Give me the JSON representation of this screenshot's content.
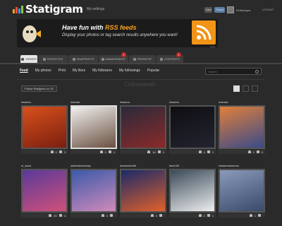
{
  "header": {
    "brand": "Statigram",
    "my_settings": "My settings",
    "like_btn": "Like",
    "tweet_btn": "Tweet",
    "username": "KelleyAgua",
    "logout": "LOGOUT",
    "logo_colors": [
      "#f4a224",
      "#e94e3c",
      "#3c9ad6",
      "#8cc63e"
    ]
  },
  "banner": {
    "title_pre": "Have fun with ",
    "title_accent": "RSS feeds",
    "subtitle": "Display your photos or tag search results anywhere you want!",
    "close": "close",
    "accent_color": "#f7a21a"
  },
  "tabs": [
    {
      "label": "VIEWER",
      "active": true,
      "badge": ""
    },
    {
      "label": "STATISTICS",
      "active": false,
      "badge": ""
    },
    {
      "label": "SNAPSHOTS",
      "active": false,
      "badge": ""
    },
    {
      "label": "MANAGEMENT",
      "active": false,
      "badge": "1"
    },
    {
      "label": "PROMOTE",
      "active": false,
      "badge": ""
    },
    {
      "label": "CONTESTS",
      "active": false,
      "badge": "1"
    }
  ],
  "subnav": [
    "Feed",
    "My photos",
    "Print",
    "My likes",
    "My followers",
    "My followings",
    "Popular"
  ],
  "search": {
    "placeholder": "Search"
  },
  "follow_button": "Follow Statigram on IG",
  "watermark": "Cuitoseando",
  "photos": [
    {
      "user": "ilmarino",
      "likes": "5",
      "comments": "3",
      "colors": [
        "#d8501c",
        "#7a1f10"
      ],
      "selected": false
    },
    {
      "user": "lmsmile",
      "likes": "3",
      "comments": "1",
      "colors": [
        "#f0f0f0",
        "#6a5040"
      ],
      "selected": true
    },
    {
      "user": "ilmarino",
      "likes": "16",
      "comments": "1",
      "colors": [
        "#2a2a3a",
        "#8a2a2a"
      ],
      "selected": false
    },
    {
      "user": "ilmarino",
      "likes": "4",
      "comments": "1",
      "colors": [
        "#0e0e12",
        "#242430"
      ],
      "selected": false
    },
    {
      "user": "mamea",
      "likes": "2",
      "comments": "5",
      "colors": [
        "#e0803a",
        "#3a4a8a"
      ],
      "selected": false
    },
    {
      "user": "ui_saca",
      "likes": "20",
      "comments": "4",
      "colors": [
        "#5a3a9a",
        "#d0507a"
      ],
      "selected": false
    },
    {
      "user": "simbioslesomap",
      "likes": "3",
      "comments": "",
      "colors": [
        "#3a5aaa",
        "#d08aba"
      ],
      "selected": false
    },
    {
      "user": "danieserio85",
      "likes": "3",
      "comments": "",
      "colors": [
        "#1a2a6a",
        "#e0602a"
      ],
      "selected": false
    },
    {
      "user": "lsenh26",
      "likes": "2",
      "comments": "1",
      "colors": [
        "#3a4a5a",
        "#eeeeee"
      ],
      "selected": false
    },
    {
      "user": "estasmolasenos",
      "likes": "1",
      "comments": "",
      "colors": [
        "#8a9aba",
        "#3a4a6a"
      ],
      "selected": false
    }
  ]
}
